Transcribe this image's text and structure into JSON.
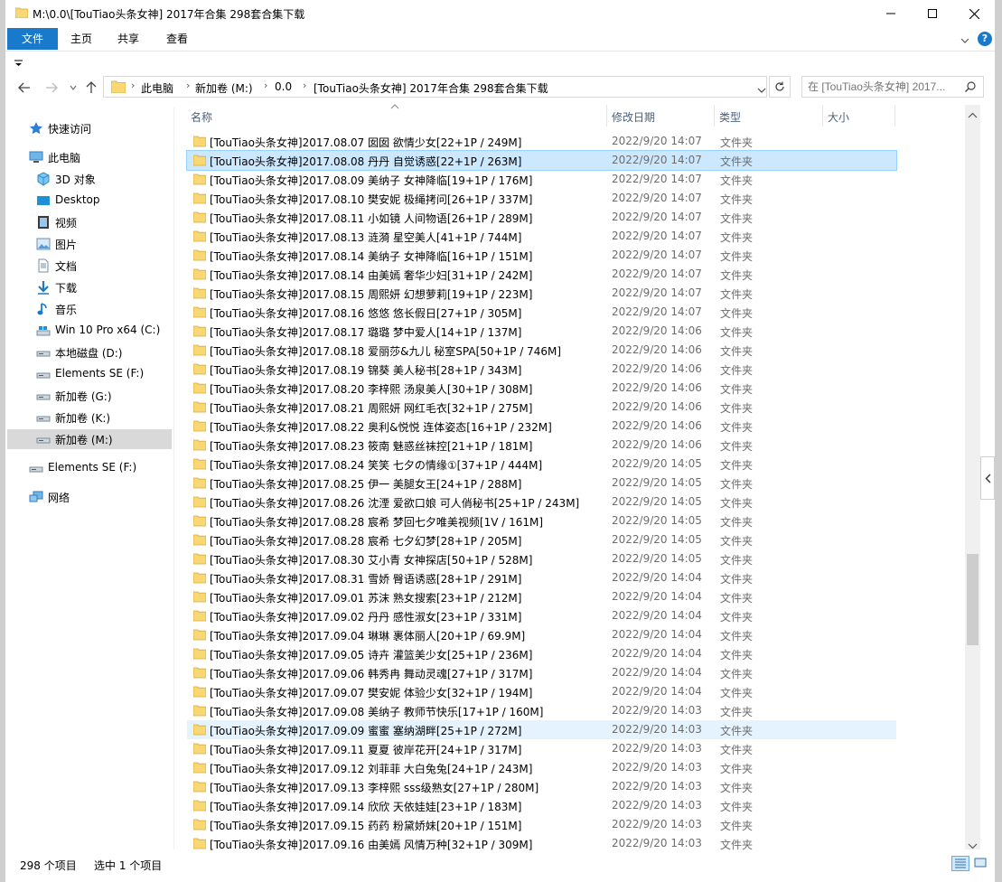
{
  "window": {
    "title": "M:\\0.0\\[TouTiao头条女神] 2017年合集 298套合集下载"
  },
  "ribbon": {
    "tabs": [
      "文件",
      "主页",
      "共享",
      "查看"
    ]
  },
  "address": {
    "crumbs": [
      "此电脑",
      "新加卷 (M:)",
      "0.0",
      "[TouTiao头条女神] 2017年合集 298套合集下载"
    ]
  },
  "search": {
    "placeholder": "在 [TouTiao头条女神] 2017..."
  },
  "sidebar": {
    "items": [
      {
        "label": "快速访问",
        "icon": "star-icon"
      },
      {
        "label": "此电脑",
        "icon": "computer-icon"
      },
      {
        "label": "3D 对象",
        "icon": "cube-icon"
      },
      {
        "label": "Desktop",
        "icon": "desktop-icon"
      },
      {
        "label": "视频",
        "icon": "video-icon"
      },
      {
        "label": "图片",
        "icon": "picture-icon"
      },
      {
        "label": "文档",
        "icon": "document-icon"
      },
      {
        "label": "下载",
        "icon": "download-icon"
      },
      {
        "label": "音乐",
        "icon": "music-icon"
      },
      {
        "label": "Win 10 Pro x64 (C:)",
        "icon": "windows-drive-icon"
      },
      {
        "label": "本地磁盘 (D:)",
        "icon": "drive-icon"
      },
      {
        "label": "Elements SE (F:)",
        "icon": "drive-icon"
      },
      {
        "label": "新加卷 (G:)",
        "icon": "drive-icon"
      },
      {
        "label": "新加卷 (K:)",
        "icon": "drive-icon"
      },
      {
        "label": "新加卷 (M:)",
        "icon": "drive-icon"
      },
      {
        "label": "Elements SE (F:)",
        "icon": "drive-icon"
      },
      {
        "label": "网络",
        "icon": "network-icon"
      }
    ]
  },
  "columns": {
    "name": "名称",
    "date": "修改日期",
    "type": "类型",
    "size": "大小"
  },
  "files": [
    {
      "name": "[TouTiao头条女神]2017.08.07 囡囡 欲情少女[22+1P / 249M]",
      "date": "2022/9/20 14:07",
      "type": "文件夹"
    },
    {
      "name": "[TouTiao头条女神]2017.08.08 丹丹 自觉诱惑[22+1P / 263M]",
      "date": "2022/9/20 14:07",
      "type": "文件夹"
    },
    {
      "name": "[TouTiao头条女神]2017.08.09 美纳子 女神降临[19+1P / 176M]",
      "date": "2022/9/20 14:07",
      "type": "文件夹"
    },
    {
      "name": "[TouTiao头条女神]2017.08.10 樊安妮 极绳拷问[26+1P / 337M]",
      "date": "2022/9/20 14:07",
      "type": "文件夹"
    },
    {
      "name": "[TouTiao头条女神]2017.08.11 小如镜 人间物语[26+1P / 289M]",
      "date": "2022/9/20 14:07",
      "type": "文件夹"
    },
    {
      "name": "[TouTiao头条女神]2017.08.13 涟漪 星空美人[41+1P / 744M]",
      "date": "2022/9/20 14:07",
      "type": "文件夹"
    },
    {
      "name": "[TouTiao头条女神]2017.08.14 美纳子 女神降临[16+1P / 151M]",
      "date": "2022/9/20 14:07",
      "type": "文件夹"
    },
    {
      "name": "[TouTiao头条女神]2017.08.14 由美嫣 奢华少妇[31+1P / 242M]",
      "date": "2022/9/20 14:07",
      "type": "文件夹"
    },
    {
      "name": "[TouTiao头条女神]2017.08.15 周熙妍 幻想萝莉[19+1P / 223M]",
      "date": "2022/9/20 14:07",
      "type": "文件夹"
    },
    {
      "name": "[TouTiao头条女神]2017.08.16 悠悠 悠长假日[27+1P / 305M]",
      "date": "2022/9/20 14:07",
      "type": "文件夹"
    },
    {
      "name": "[TouTiao头条女神]2017.08.17 璐璐 梦中爱人[14+1P / 137M]",
      "date": "2022/9/20 14:06",
      "type": "文件夹"
    },
    {
      "name": "[TouTiao头条女神]2017.08.18 爱丽莎&九儿 秘室SPA[50+1P / 746M]",
      "date": "2022/9/20 14:06",
      "type": "文件夹"
    },
    {
      "name": "[TouTiao头条女神]2017.08.19 锦葵 美人秘书[28+1P / 343M]",
      "date": "2022/9/20 14:06",
      "type": "文件夹"
    },
    {
      "name": "[TouTiao头条女神]2017.08.20 李梓熙 汤泉美人[30+1P / 308M]",
      "date": "2022/9/20 14:06",
      "type": "文件夹"
    },
    {
      "name": "[TouTiao头条女神]2017.08.21 周熙妍 网红毛衣[32+1P / 275M]",
      "date": "2022/9/20 14:06",
      "type": "文件夹"
    },
    {
      "name": "[TouTiao头条女神]2017.08.22 奥利&悦悦 连体姿态[16+1P / 232M]",
      "date": "2022/9/20 14:06",
      "type": "文件夹"
    },
    {
      "name": "[TouTiao头条女神]2017.08.23 筱南 魅惑丝袜控[21+1P / 181M]",
      "date": "2022/9/20 14:06",
      "type": "文件夹"
    },
    {
      "name": "[TouTiao头条女神]2017.08.24 笑笑 七夕の情缘①[37+1P / 444M]",
      "date": "2022/9/20 14:05",
      "type": "文件夹"
    },
    {
      "name": "[TouTiao头条女神]2017.08.25 伊一 美腿女王[24+1P / 288M]",
      "date": "2022/9/20 14:05",
      "type": "文件夹"
    },
    {
      "name": "[TouTiao头条女神]2017.08.26 沈湮 爱欲口娘 可人俏秘书[25+1P / 243M]",
      "date": "2022/9/20 14:05",
      "type": "文件夹"
    },
    {
      "name": "[TouTiao头条女神]2017.08.28 宸希 梦回七夕唯美视频[1V / 161M]",
      "date": "2022/9/20 14:05",
      "type": "文件夹"
    },
    {
      "name": "[TouTiao头条女神]2017.08.28 宸希 七夕幻梦[28+1P / 205M]",
      "date": "2022/9/20 14:05",
      "type": "文件夹"
    },
    {
      "name": "[TouTiao头条女神]2017.08.30 艾小青 女神探店[50+1P / 528M]",
      "date": "2022/9/20 14:05",
      "type": "文件夹"
    },
    {
      "name": "[TouTiao头条女神]2017.08.31 雪娇 臀语诱惑[28+1P / 291M]",
      "date": "2022/9/20 14:04",
      "type": "文件夹"
    },
    {
      "name": "[TouTiao头条女神]2017.09.01 苏沫 熟女搜索[23+1P / 212M]",
      "date": "2022/9/20 14:04",
      "type": "文件夹"
    },
    {
      "name": "[TouTiao头条女神]2017.09.02 丹丹 感性淑女[23+1P / 331M]",
      "date": "2022/9/20 14:04",
      "type": "文件夹"
    },
    {
      "name": "[TouTiao头条女神]2017.09.04 琳琳 裹体丽人[20+1P / 69.9M]",
      "date": "2022/9/20 14:04",
      "type": "文件夹"
    },
    {
      "name": "[TouTiao头条女神]2017.09.05 诗卉 灌篮美少女[25+1P / 236M]",
      "date": "2022/9/20 14:04",
      "type": "文件夹"
    },
    {
      "name": "[TouTiao头条女神]2017.09.06 韩秀冉 舞动灵魂[27+1P / 317M]",
      "date": "2022/9/20 14:04",
      "type": "文件夹"
    },
    {
      "name": "[TouTiao头条女神]2017.09.07 樊安妮 体验少女[32+1P / 194M]",
      "date": "2022/9/20 14:04",
      "type": "文件夹"
    },
    {
      "name": "[TouTiao头条女神]2017.09.08 美纳子 教师节快乐[17+1P / 160M]",
      "date": "2022/9/20 14:03",
      "type": "文件夹"
    },
    {
      "name": "[TouTiao头条女神]2017.09.09 蜜蜜 塞纳湖畔[25+1P / 272M]",
      "date": "2022/9/20 14:03",
      "type": "文件夹"
    },
    {
      "name": "[TouTiao头条女神]2017.09.11 夏夏 彼岸花开[24+1P / 317M]",
      "date": "2022/9/20 14:03",
      "type": "文件夹"
    },
    {
      "name": "[TouTiao头条女神]2017.09.12 刘菲菲 大白兔兔[24+1P / 243M]",
      "date": "2022/9/20 14:03",
      "type": "文件夹"
    },
    {
      "name": "[TouTiao头条女神]2017.09.13 李梓熙 sss级熟女[27+1P / 280M]",
      "date": "2022/9/20 14:03",
      "type": "文件夹"
    },
    {
      "name": "[TouTiao头条女神]2017.09.14 欣欣 天依娃娃[23+1P / 183M]",
      "date": "2022/9/20 14:03",
      "type": "文件夹"
    },
    {
      "name": "[TouTiao头条女神]2017.09.15 药药 粉黛娇妹[20+1P / 151M]",
      "date": "2022/9/20 14:03",
      "type": "文件夹"
    },
    {
      "name": "[TouTiao头条女神]2017.09.16 由美嫣 风情万种[32+1P / 309M]",
      "date": "2022/9/20 14:03",
      "type": "文件夹"
    }
  ],
  "selected_index": 1,
  "hover_index": 31,
  "status": {
    "count": "298 个项目",
    "selected": "选中 1 个项目"
  },
  "colors": {
    "accent": "#1979ca",
    "selected_row": "#cce8ff",
    "hover_row": "#e5f3ff",
    "folder": "#f8d775",
    "header_text": "#4c607a"
  }
}
